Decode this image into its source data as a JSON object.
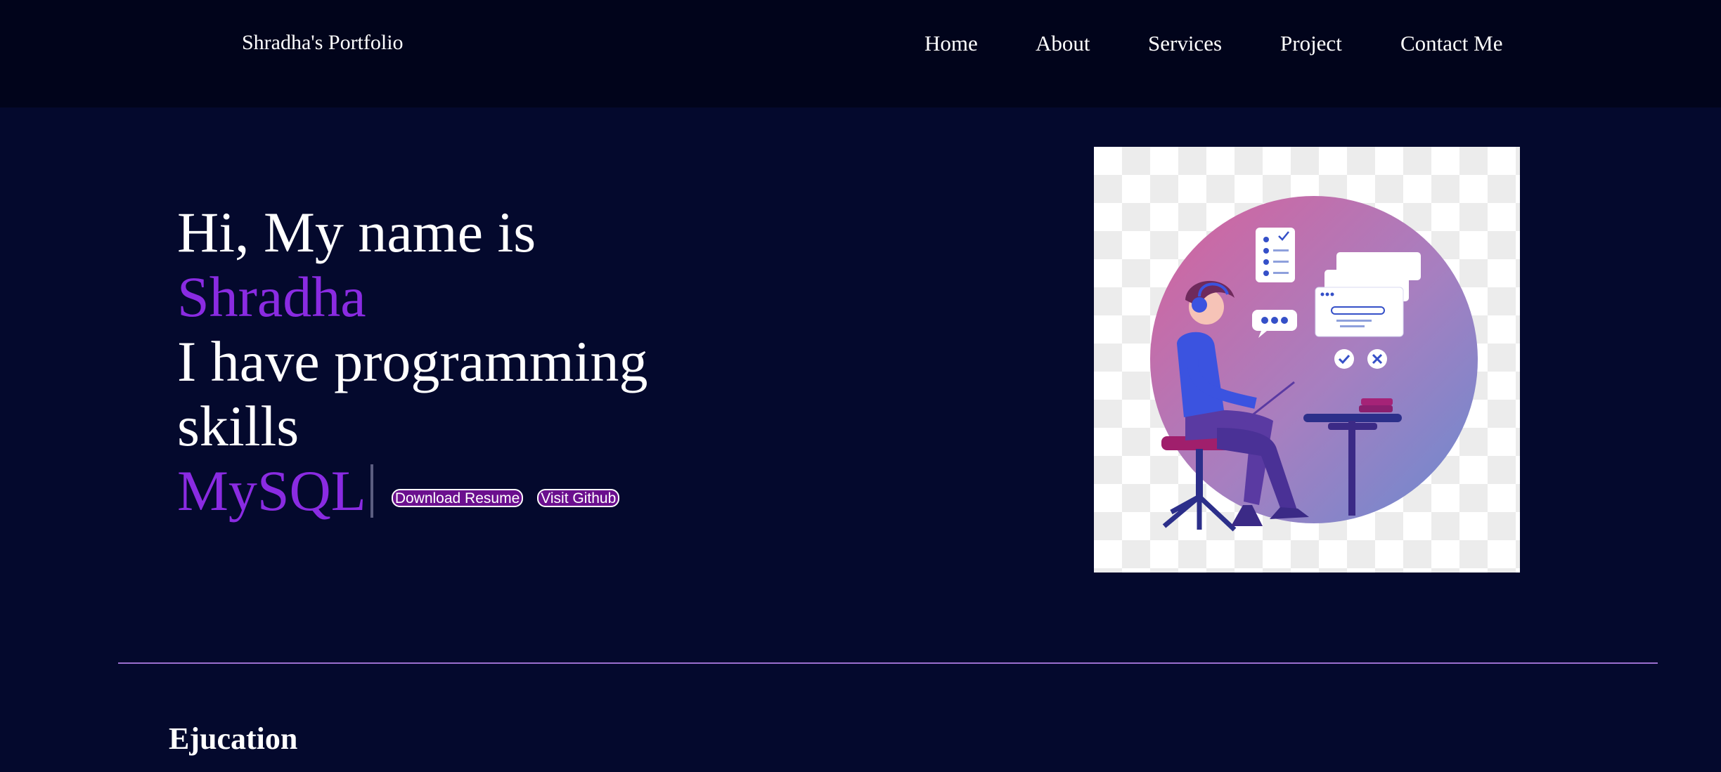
{
  "navbar": {
    "brand": "Shradha's Portfolio",
    "links": [
      "Home",
      "About",
      "Services",
      "Project",
      "Contact Me"
    ]
  },
  "hero": {
    "greeting": "Hi, My name is",
    "name": "Shradha",
    "skills_line_1": "I have programming",
    "skills_line_2": "skills",
    "typed_word": "MySQL",
    "buttons": {
      "download_resume": "Download Resume",
      "visit_github": "Visit Github"
    },
    "image_icon": "developer-illustration"
  },
  "sections": {
    "education_heading": "Ejucation"
  },
  "colors": {
    "page_background": "#04092d",
    "navbar_background": "#01041b",
    "accent_purple": "#8a2be2",
    "button_background": "#6b0f8e",
    "divider": "#9b6fd0"
  }
}
